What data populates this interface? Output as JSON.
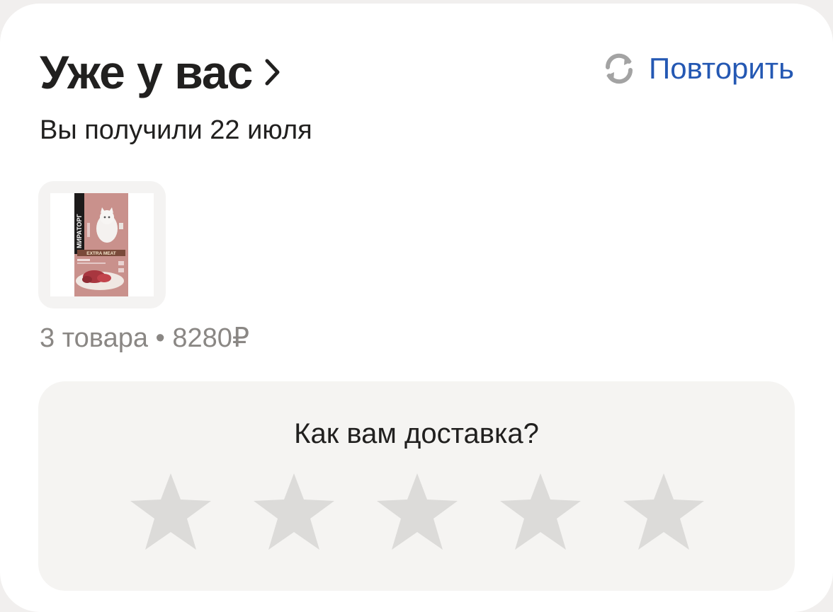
{
  "header": {
    "title": "Уже у вас",
    "repeat_label": "Повторить"
  },
  "order": {
    "received_text": "Вы получили 22 июля",
    "product": {
      "brand": "МИРАТОРГ",
      "line": "EXTRA MEAT"
    },
    "summary": "3 товара • 8280₽"
  },
  "rating": {
    "question": "Как вам доставка?",
    "max_stars": 5,
    "selected_stars": 0,
    "star_color": "#dcdbd9"
  },
  "colors": {
    "accent_link": "#2458b3",
    "text_primary": "#21201f",
    "text_secondary": "#8a8784"
  }
}
